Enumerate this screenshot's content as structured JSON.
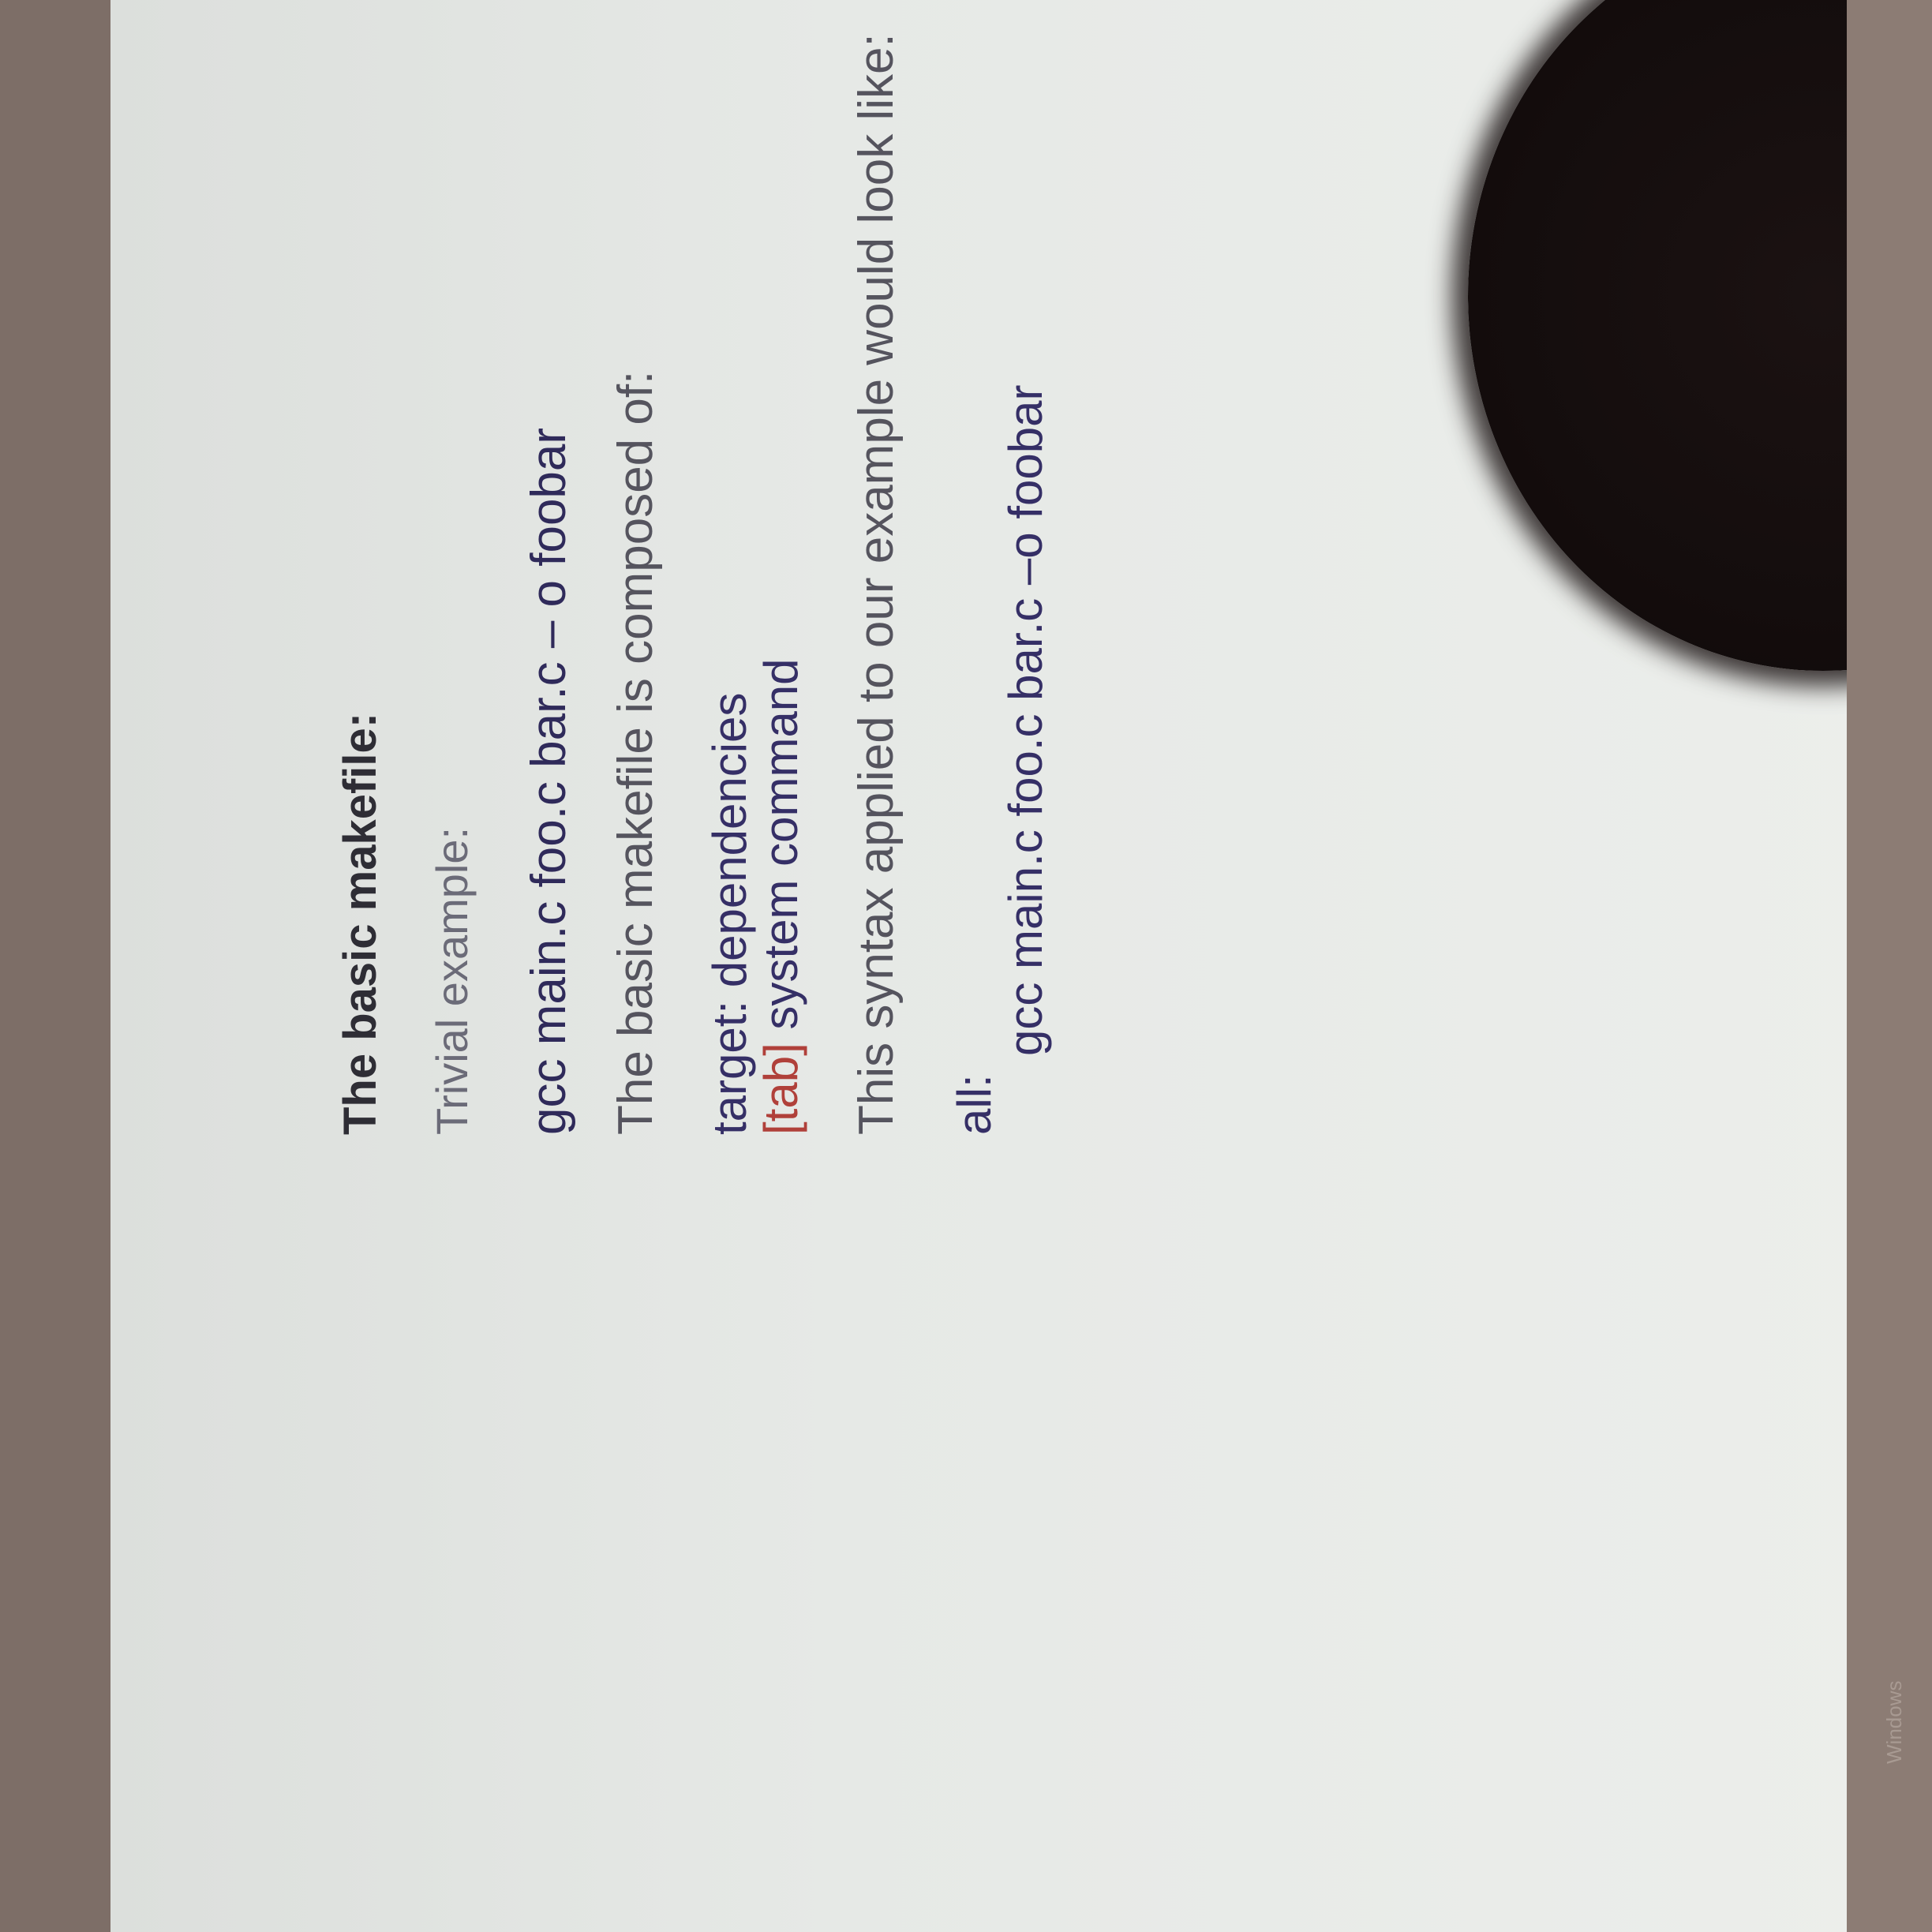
{
  "slide": {
    "heading": "The basic makefile:",
    "subheading": "Trivial example:",
    "command_example": "gcc main.c foo.c bar.c – o foobar",
    "composed_text": "The basic makefile is composed of:",
    "syntax_line1": "target: dependencies",
    "syntax_line2_tab": "[tab]",
    "syntax_line2_rest": " system command",
    "applied_text": "This syntax applied to our example would look like:",
    "rule_target": "all:",
    "rule_command": "gcc main.c foo.c bar.c –o foobar"
  },
  "taskbar": {
    "label": "Windows"
  }
}
